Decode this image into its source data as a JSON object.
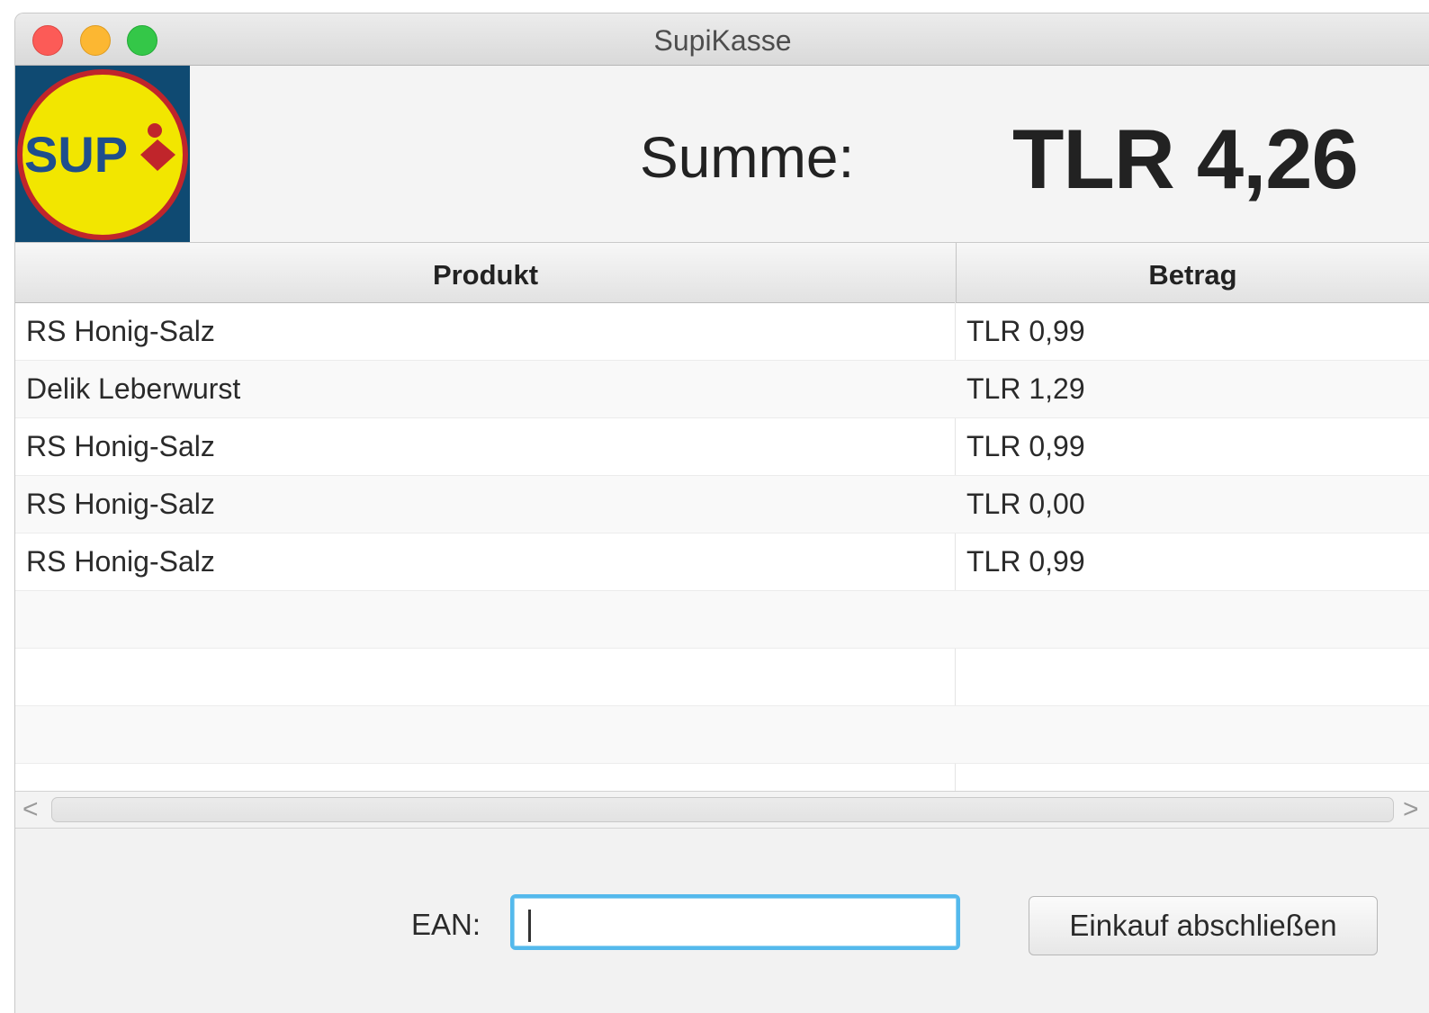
{
  "window": {
    "title": "SupiKasse"
  },
  "header": {
    "logo_text": "SUP",
    "sum_label": "Summe:",
    "sum_value": "TLR 4,26"
  },
  "table": {
    "columns": [
      "Produkt",
      "Betrag"
    ],
    "rows": [
      {
        "produkt": "RS Honig-Salz",
        "betrag": "TLR 0,99"
      },
      {
        "produkt": "Delik Leberwurst",
        "betrag": "TLR 1,29"
      },
      {
        "produkt": "RS Honig-Salz",
        "betrag": "TLR 0,99"
      },
      {
        "produkt": "RS Honig-Salz",
        "betrag": "TLR 0,00"
      },
      {
        "produkt": "RS Honig-Salz",
        "betrag": "TLR 0,99"
      },
      {
        "produkt": "",
        "betrag": ""
      },
      {
        "produkt": "",
        "betrag": ""
      },
      {
        "produkt": "",
        "betrag": ""
      },
      {
        "produkt": "",
        "betrag": ""
      }
    ]
  },
  "footer": {
    "ean_label": "EAN:",
    "ean_value": "",
    "finish_button_label": "Einkauf abschließen"
  },
  "colors": {
    "logo_background": "#0f4a72",
    "logo_circle": "#f2e600",
    "logo_ring": "#c0252b",
    "logo_text": "#1f4e8c",
    "focus_ring": "#54b9ec"
  }
}
